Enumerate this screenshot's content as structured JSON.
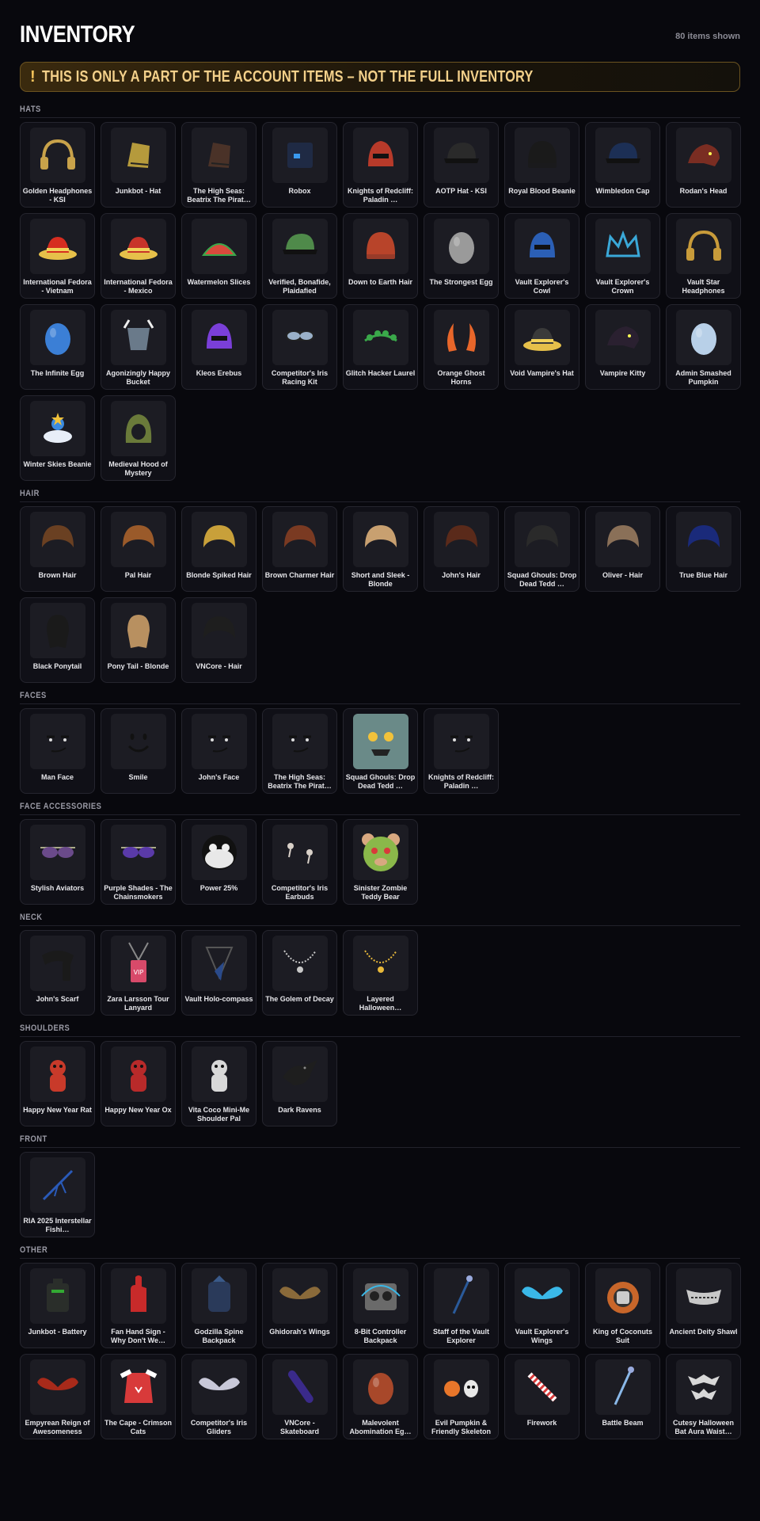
{
  "header": {
    "title": "INVENTORY",
    "count_label": "80 items shown"
  },
  "warning": {
    "icon": "!",
    "text": "THIS IS ONLY A PART OF THE ACCOUNT ITEMS – NOT THE FULL INVENTORY"
  },
  "categories": [
    {
      "title": "HATS",
      "items": [
        {
          "name": "Golden Headphones - KSI",
          "icon": "headphones",
          "color": "#c8a24a"
        },
        {
          "name": "Junkbot - Hat",
          "icon": "hat",
          "color": "#b59a3c"
        },
        {
          "name": "The High Seas: Beatrix The Pirat…",
          "icon": "hat",
          "color": "#4a3228"
        },
        {
          "name": "Robox",
          "icon": "box",
          "color": "#1f2a44"
        },
        {
          "name": "Knights of Redcliff: Paladin …",
          "icon": "helmet",
          "color": "#b73a2a"
        },
        {
          "name": "AOTP Hat - KSI",
          "icon": "cap",
          "color": "#2a2a2a"
        },
        {
          "name": "Royal Blood Beanie",
          "icon": "beanie",
          "color": "#1a1a1a"
        },
        {
          "name": "Wimbledon Cap",
          "icon": "cap",
          "color": "#1c2f55"
        },
        {
          "name": "Rodan's Head",
          "icon": "creature",
          "color": "#7a2d22"
        },
        {
          "name": "International Fedora - Vietnam",
          "icon": "fedora",
          "color": "#d62d20"
        },
        {
          "name": "International Fedora - Mexico",
          "icon": "fedora",
          "color": "#c8332a"
        },
        {
          "name": "Watermelon Slices",
          "icon": "melon",
          "color": "#d94a3c"
        },
        {
          "name": "Verified, Bonafide, Plaidafied",
          "icon": "cap",
          "color": "#4f8a4a"
        },
        {
          "name": "Down to Earth Hair",
          "icon": "beanie",
          "color": "#b8442a"
        },
        {
          "name": "The Strongest Egg",
          "icon": "egg",
          "color": "#9a9a9a"
        },
        {
          "name": "Vault Explorer's Cowl",
          "icon": "helmet",
          "color": "#2b5fb5"
        },
        {
          "name": "Vault Explorer's Crown",
          "icon": "crown",
          "color": "#3aa8d8"
        },
        {
          "name": "Vault Star Headphones",
          "icon": "headphones",
          "color": "#c89b3a"
        },
        {
          "name": "The Infinite Egg",
          "icon": "egg",
          "color": "#3b7fd6"
        },
        {
          "name": "Agonizingly Happy Bucket",
          "icon": "bucket",
          "color": "#6a7a8a"
        },
        {
          "name": "Kleos Erebus",
          "icon": "helmet",
          "color": "#7a3fd8"
        },
        {
          "name": "Competitor's Iris Racing Kit",
          "icon": "goggles",
          "color": "#9ab0c8"
        },
        {
          "name": "Glitch Hacker Laurel",
          "icon": "laurel",
          "color": "#3aa84a"
        },
        {
          "name": "Orange Ghost Horns",
          "icon": "horns",
          "color": "#e8662a"
        },
        {
          "name": "Void Vampire's Hat",
          "icon": "fedora",
          "color": "#3a3a3a"
        },
        {
          "name": "Vampire Kitty",
          "icon": "creature",
          "color": "#2a2030"
        },
        {
          "name": "Admin Smashed Pumpkin",
          "icon": "egg",
          "color": "#b8d0e8"
        },
        {
          "name": "Winter Skies Beanie",
          "icon": "cloud",
          "color": "#e8eef8"
        },
        {
          "name": "Medieval Hood of Mystery",
          "icon": "hood",
          "color": "#6a7a3a"
        }
      ]
    },
    {
      "title": "HAIR",
      "items": [
        {
          "name": "Brown Hair",
          "icon": "hair",
          "color": "#6a4022"
        },
        {
          "name": "Pal Hair",
          "icon": "hair",
          "color": "#9a5a2a"
        },
        {
          "name": "Blonde Spiked Hair",
          "icon": "hair",
          "color": "#c8a03a"
        },
        {
          "name": "Brown Charmer Hair",
          "icon": "hair",
          "color": "#7a3a22"
        },
        {
          "name": "Short and Sleek - Blonde",
          "icon": "hair",
          "color": "#c8a070"
        },
        {
          "name": "John's Hair",
          "icon": "hair",
          "color": "#5a2a1a"
        },
        {
          "name": "Squad Ghouls: Drop Dead Tedd …",
          "icon": "hair",
          "color": "#2a2a2a"
        },
        {
          "name": "Oliver - Hair",
          "icon": "hair",
          "color": "#8a7058"
        },
        {
          "name": "True Blue Hair",
          "icon": "hair",
          "color": "#1a2a7a"
        },
        {
          "name": "Black Ponytail",
          "icon": "ponytail",
          "color": "#1a1a1a"
        },
        {
          "name": "Pony Tail - Blonde",
          "icon": "ponytail",
          "color": "#b89060"
        },
        {
          "name": "VNCore - Hair",
          "icon": "hair",
          "color": "#1e1e1e"
        }
      ]
    },
    {
      "title": "FACES",
      "items": [
        {
          "name": "Man Face",
          "icon": "face",
          "color": "#1c1c23"
        },
        {
          "name": "Smile",
          "icon": "smile",
          "color": "#1c1c23"
        },
        {
          "name": "John's Face",
          "icon": "face",
          "color": "#1c1c23"
        },
        {
          "name": "The High Seas: Beatrix The Pirat…",
          "icon": "face",
          "color": "#1c1c23"
        },
        {
          "name": "Squad Ghouls: Drop Dead Tedd …",
          "icon": "ghoulface",
          "color": "#6a8a88"
        },
        {
          "name": "Knights of Redcliff: Paladin …",
          "icon": "face",
          "color": "#1c1c23"
        }
      ]
    },
    {
      "title": "FACE ACCESSORIES",
      "items": [
        {
          "name": "Stylish Aviators",
          "icon": "glasses",
          "color": "#6a4a8a"
        },
        {
          "name": "Purple Shades - The Chainsmokers",
          "icon": "glasses",
          "color": "#5a3aa8"
        },
        {
          "name": "Power 25%",
          "icon": "mask",
          "color": "#e8e8e8"
        },
        {
          "name": "Competitor's Iris Earbuds",
          "icon": "earbuds",
          "color": "#d8d0c8"
        },
        {
          "name": "Sinister Zombie Teddy Bear",
          "icon": "bear",
          "color": "#8ab84a"
        }
      ]
    },
    {
      "title": "NECK",
      "items": [
        {
          "name": "John's Scarf",
          "icon": "scarf",
          "color": "#1a1a1a"
        },
        {
          "name": "Zara Larsson Tour Lanyard",
          "icon": "lanyard",
          "color": "#d84a6a"
        },
        {
          "name": "Vault Holo-compass",
          "icon": "compass",
          "color": "#2a4a8a"
        },
        {
          "name": "The Golem of Decay",
          "icon": "necklace",
          "color": "#c8c8c8"
        },
        {
          "name": "Layered Halloween…",
          "icon": "necklace",
          "color": "#e8b83a"
        }
      ]
    },
    {
      "title": "SHOULDERS",
      "items": [
        {
          "name": "Happy New Year Rat",
          "icon": "pet",
          "color": "#c83a2a"
        },
        {
          "name": "Happy New Year Ox",
          "icon": "pet",
          "color": "#b82a2a"
        },
        {
          "name": "Vita Coco Mini-Me Shoulder Pal",
          "icon": "pet",
          "color": "#d8d8d8"
        },
        {
          "name": "Dark Ravens",
          "icon": "raven",
          "color": "#1e1e1e"
        }
      ]
    },
    {
      "title": "FRONT",
      "items": [
        {
          "name": "RIA 2025 Interstellar Fishi…",
          "icon": "rod",
          "color": "#2a5ab8"
        }
      ]
    },
    {
      "title": "OTHER",
      "items": [
        {
          "name": "Junkbot - Battery",
          "icon": "battery",
          "color": "#2a2e2a"
        },
        {
          "name": "Fan Hand Sign - Why Don't We…",
          "icon": "foamhand",
          "color": "#c82a2a"
        },
        {
          "name": "Godzilla Spine Backpack",
          "icon": "backpack",
          "color": "#2a3a5a"
        },
        {
          "name": "Ghidorah's Wings",
          "icon": "wings",
          "color": "#8a6a3a"
        },
        {
          "name": "8-Bit Controller Backpack",
          "icon": "controller",
          "color": "#6a6a6a"
        },
        {
          "name": "Staff of the Vault Explorer",
          "icon": "staff",
          "color": "#2a5a9a"
        },
        {
          "name": "Vault Explorer's Wings",
          "icon": "wings",
          "color": "#3ab8e8"
        },
        {
          "name": "King of Coconuts Suit",
          "icon": "coconut",
          "color": "#c8662a"
        },
        {
          "name": "Ancient Deity Shawl",
          "icon": "shawl",
          "color": "#c8c8c8"
        },
        {
          "name": "Empyrean Reign of Awesomeness",
          "icon": "wings",
          "color": "#a82a1a"
        },
        {
          "name": "The Cape - Crimson Cats",
          "icon": "cape",
          "color": "#d83a3a"
        },
        {
          "name": "Competitor's Iris Gliders",
          "icon": "wings",
          "color": "#c8c8d8"
        },
        {
          "name": "VNCore - Skateboard",
          "icon": "skateboard",
          "color": "#3a2a8a"
        },
        {
          "name": "Malevolent Abomination Eg…",
          "icon": "egg",
          "color": "#a8482a"
        },
        {
          "name": "Evil Pumpkin & Friendly Skeleton",
          "icon": "pumpkin",
          "color": "#e8762a"
        },
        {
          "name": "Firework",
          "icon": "firework",
          "color": "#d83a3a"
        },
        {
          "name": "Battle Beam",
          "icon": "staff",
          "color": "#8ab8e8"
        },
        {
          "name": "Cutesy Halloween Bat Aura Waist…",
          "icon": "bats",
          "color": "#d8d8d8"
        }
      ]
    }
  ]
}
